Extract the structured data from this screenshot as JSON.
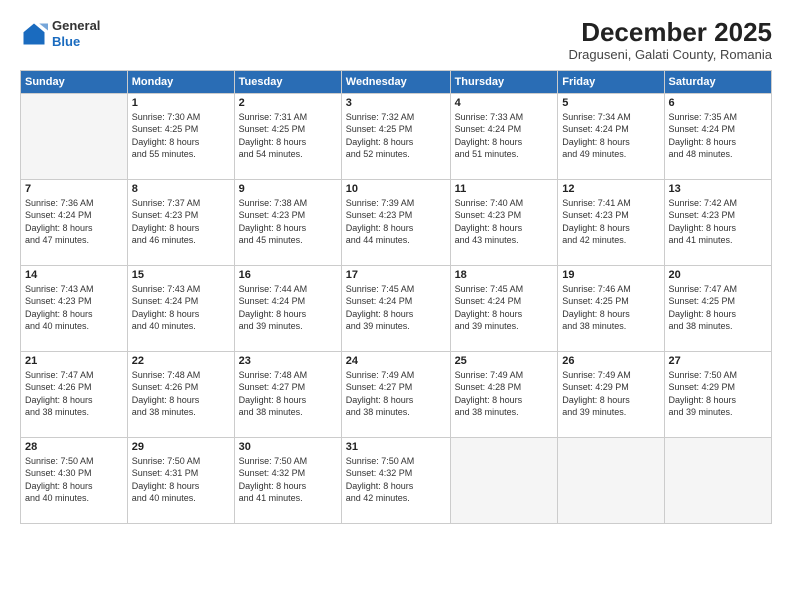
{
  "logo": {
    "general": "General",
    "blue": "Blue"
  },
  "header": {
    "month": "December 2025",
    "location": "Draguseni, Galati County, Romania"
  },
  "weekdays": [
    "Sunday",
    "Monday",
    "Tuesday",
    "Wednesday",
    "Thursday",
    "Friday",
    "Saturday"
  ],
  "weeks": [
    [
      {
        "day": "",
        "info": ""
      },
      {
        "day": "1",
        "info": "Sunrise: 7:30 AM\nSunset: 4:25 PM\nDaylight: 8 hours\nand 55 minutes."
      },
      {
        "day": "2",
        "info": "Sunrise: 7:31 AM\nSunset: 4:25 PM\nDaylight: 8 hours\nand 54 minutes."
      },
      {
        "day": "3",
        "info": "Sunrise: 7:32 AM\nSunset: 4:25 PM\nDaylight: 8 hours\nand 52 minutes."
      },
      {
        "day": "4",
        "info": "Sunrise: 7:33 AM\nSunset: 4:24 PM\nDaylight: 8 hours\nand 51 minutes."
      },
      {
        "day": "5",
        "info": "Sunrise: 7:34 AM\nSunset: 4:24 PM\nDaylight: 8 hours\nand 49 minutes."
      },
      {
        "day": "6",
        "info": "Sunrise: 7:35 AM\nSunset: 4:24 PM\nDaylight: 8 hours\nand 48 minutes."
      }
    ],
    [
      {
        "day": "7",
        "info": "Sunrise: 7:36 AM\nSunset: 4:24 PM\nDaylight: 8 hours\nand 47 minutes."
      },
      {
        "day": "8",
        "info": "Sunrise: 7:37 AM\nSunset: 4:23 PM\nDaylight: 8 hours\nand 46 minutes."
      },
      {
        "day": "9",
        "info": "Sunrise: 7:38 AM\nSunset: 4:23 PM\nDaylight: 8 hours\nand 45 minutes."
      },
      {
        "day": "10",
        "info": "Sunrise: 7:39 AM\nSunset: 4:23 PM\nDaylight: 8 hours\nand 44 minutes."
      },
      {
        "day": "11",
        "info": "Sunrise: 7:40 AM\nSunset: 4:23 PM\nDaylight: 8 hours\nand 43 minutes."
      },
      {
        "day": "12",
        "info": "Sunrise: 7:41 AM\nSunset: 4:23 PM\nDaylight: 8 hours\nand 42 minutes."
      },
      {
        "day": "13",
        "info": "Sunrise: 7:42 AM\nSunset: 4:23 PM\nDaylight: 8 hours\nand 41 minutes."
      }
    ],
    [
      {
        "day": "14",
        "info": "Sunrise: 7:43 AM\nSunset: 4:23 PM\nDaylight: 8 hours\nand 40 minutes."
      },
      {
        "day": "15",
        "info": "Sunrise: 7:43 AM\nSunset: 4:24 PM\nDaylight: 8 hours\nand 40 minutes."
      },
      {
        "day": "16",
        "info": "Sunrise: 7:44 AM\nSunset: 4:24 PM\nDaylight: 8 hours\nand 39 minutes."
      },
      {
        "day": "17",
        "info": "Sunrise: 7:45 AM\nSunset: 4:24 PM\nDaylight: 8 hours\nand 39 minutes."
      },
      {
        "day": "18",
        "info": "Sunrise: 7:45 AM\nSunset: 4:24 PM\nDaylight: 8 hours\nand 39 minutes."
      },
      {
        "day": "19",
        "info": "Sunrise: 7:46 AM\nSunset: 4:25 PM\nDaylight: 8 hours\nand 38 minutes."
      },
      {
        "day": "20",
        "info": "Sunrise: 7:47 AM\nSunset: 4:25 PM\nDaylight: 8 hours\nand 38 minutes."
      }
    ],
    [
      {
        "day": "21",
        "info": "Sunrise: 7:47 AM\nSunset: 4:26 PM\nDaylight: 8 hours\nand 38 minutes."
      },
      {
        "day": "22",
        "info": "Sunrise: 7:48 AM\nSunset: 4:26 PM\nDaylight: 8 hours\nand 38 minutes."
      },
      {
        "day": "23",
        "info": "Sunrise: 7:48 AM\nSunset: 4:27 PM\nDaylight: 8 hours\nand 38 minutes."
      },
      {
        "day": "24",
        "info": "Sunrise: 7:49 AM\nSunset: 4:27 PM\nDaylight: 8 hours\nand 38 minutes."
      },
      {
        "day": "25",
        "info": "Sunrise: 7:49 AM\nSunset: 4:28 PM\nDaylight: 8 hours\nand 38 minutes."
      },
      {
        "day": "26",
        "info": "Sunrise: 7:49 AM\nSunset: 4:29 PM\nDaylight: 8 hours\nand 39 minutes."
      },
      {
        "day": "27",
        "info": "Sunrise: 7:50 AM\nSunset: 4:29 PM\nDaylight: 8 hours\nand 39 minutes."
      }
    ],
    [
      {
        "day": "28",
        "info": "Sunrise: 7:50 AM\nSunset: 4:30 PM\nDaylight: 8 hours\nand 40 minutes."
      },
      {
        "day": "29",
        "info": "Sunrise: 7:50 AM\nSunset: 4:31 PM\nDaylight: 8 hours\nand 40 minutes."
      },
      {
        "day": "30",
        "info": "Sunrise: 7:50 AM\nSunset: 4:32 PM\nDaylight: 8 hours\nand 41 minutes."
      },
      {
        "day": "31",
        "info": "Sunrise: 7:50 AM\nSunset: 4:32 PM\nDaylight: 8 hours\nand 42 minutes."
      },
      {
        "day": "",
        "info": ""
      },
      {
        "day": "",
        "info": ""
      },
      {
        "day": "",
        "info": ""
      }
    ]
  ]
}
